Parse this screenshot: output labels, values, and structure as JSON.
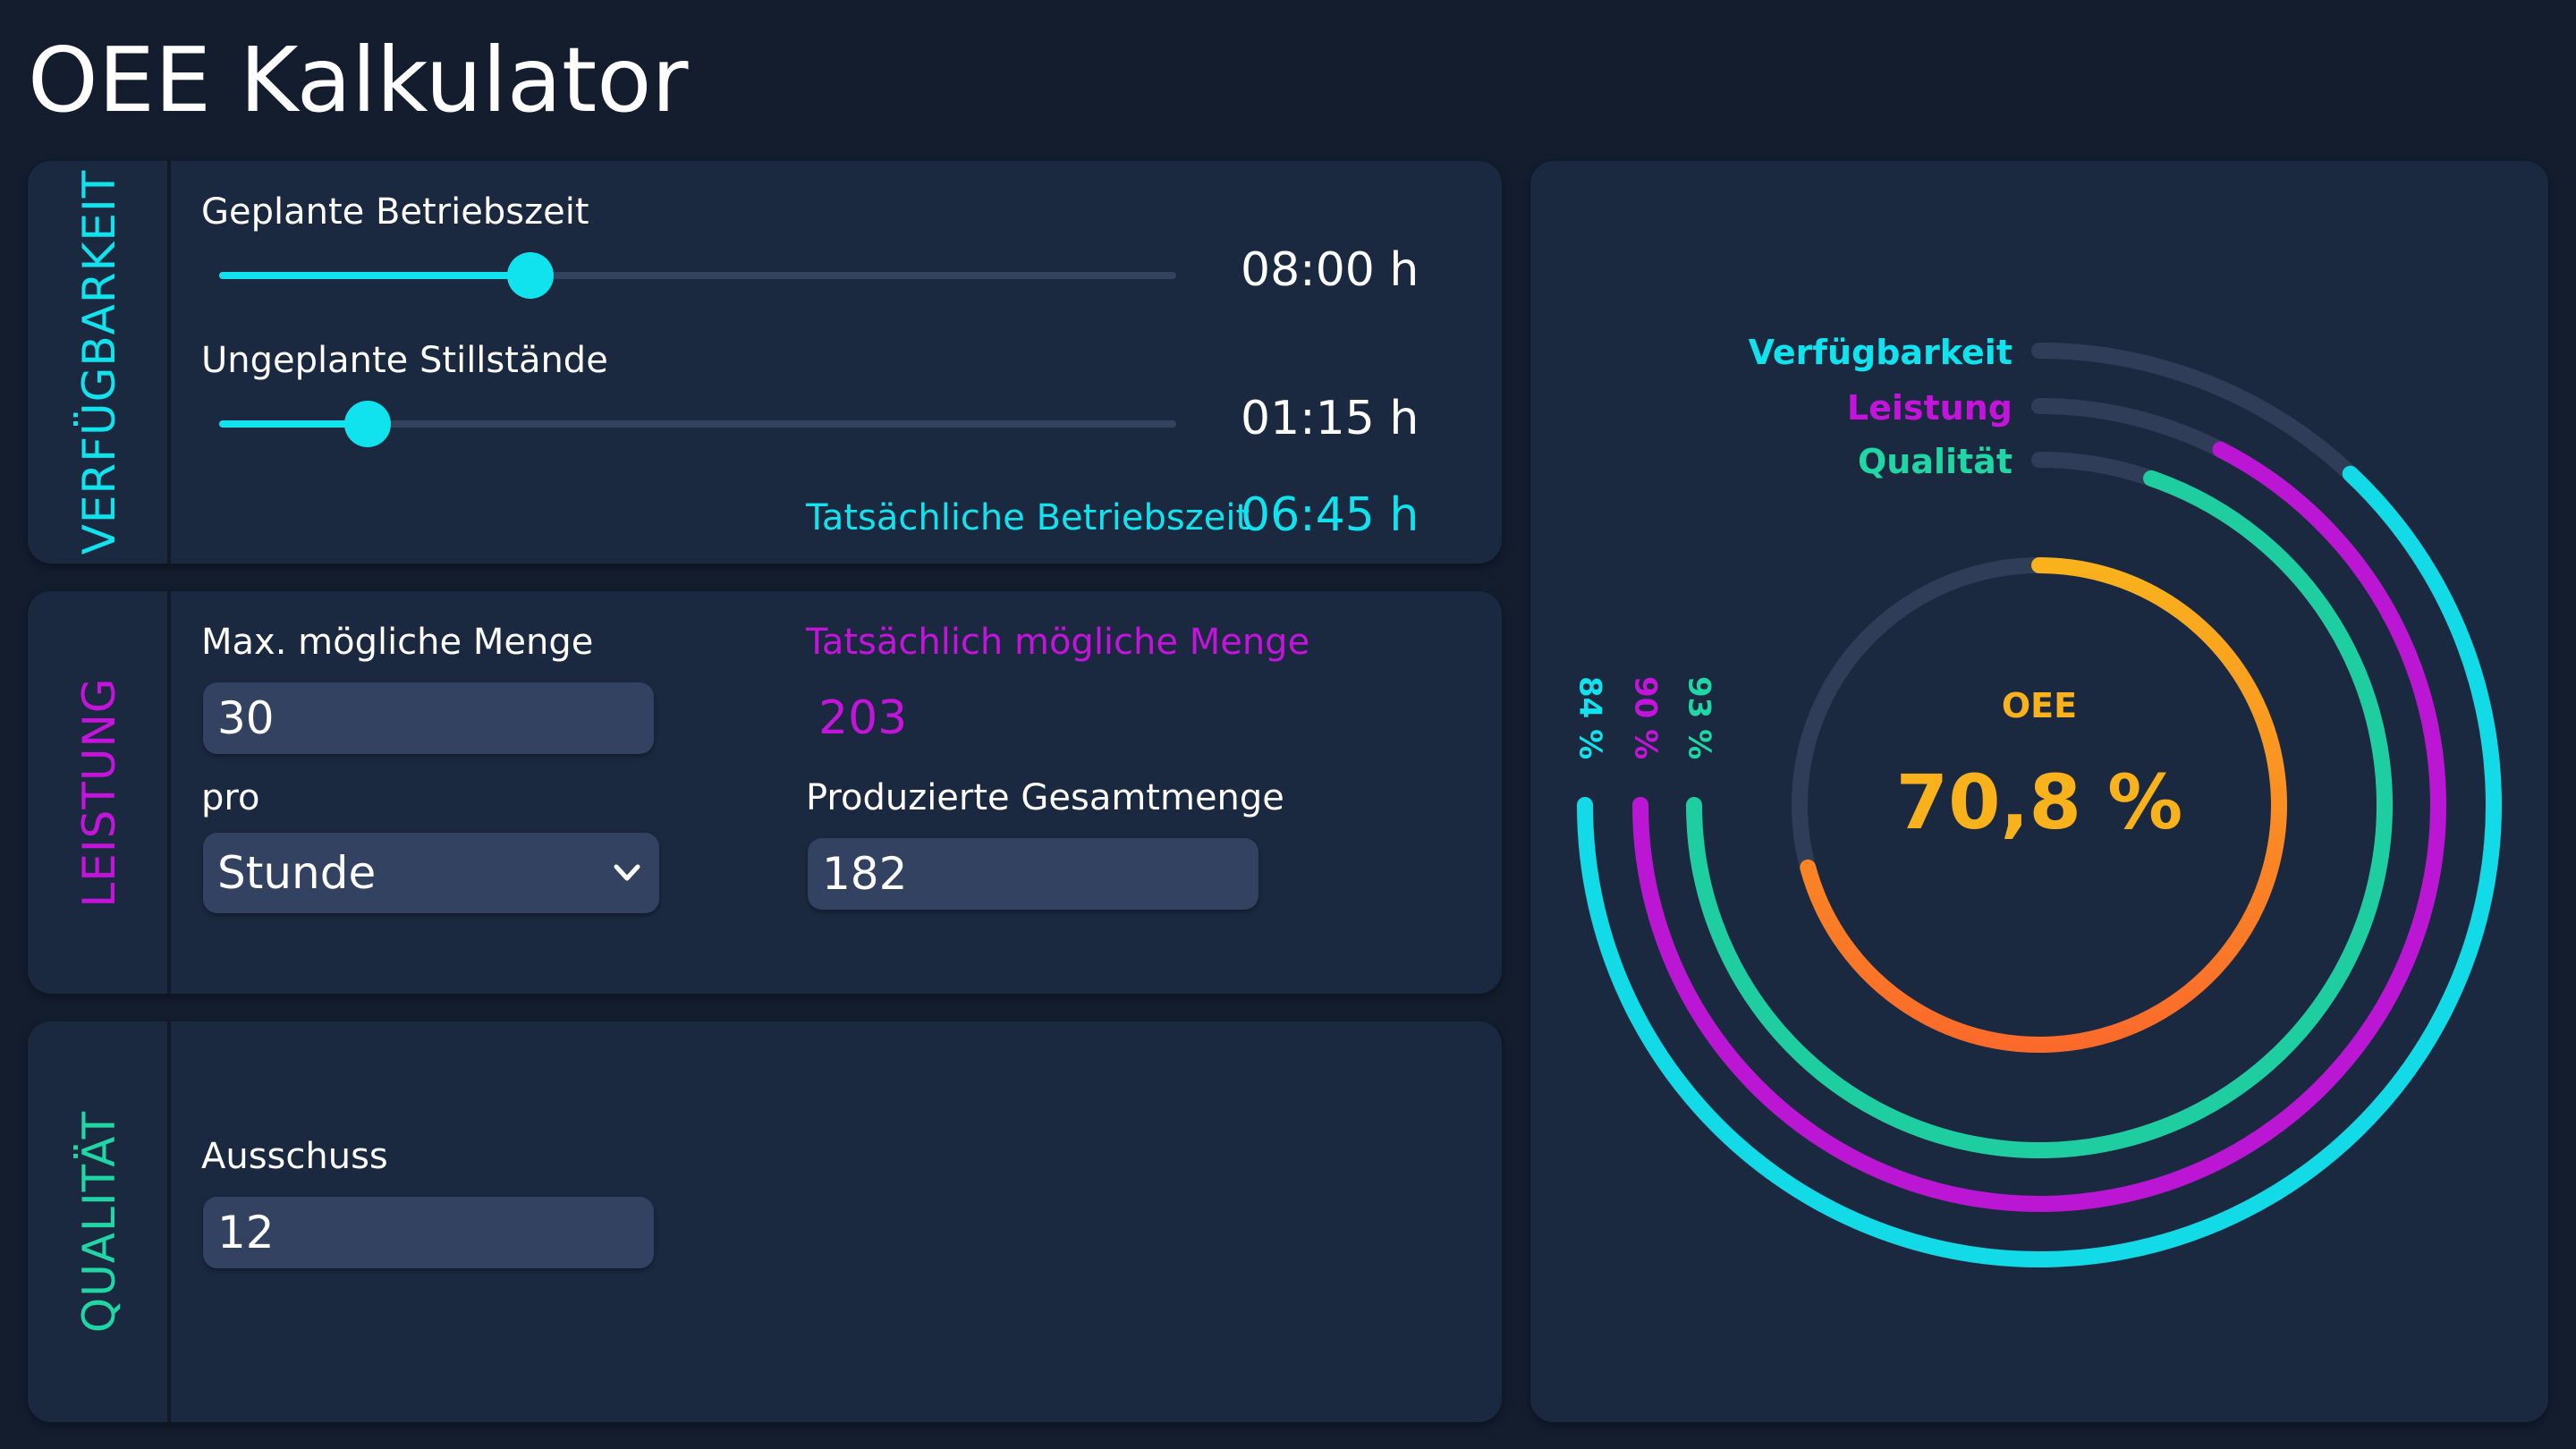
{
  "app": {
    "title": "OEE Kalkulator"
  },
  "colors": {
    "availability": "#11e3ee",
    "performance": "#c414dc",
    "quality": "#1fd6a4",
    "oee": "#f9b21c"
  },
  "availability_panel": {
    "label": "VERFÜGBARKEIT",
    "planned_label": "Geplante Betriebszeit",
    "planned_value": "08:00 h",
    "planned_slider": 0.325,
    "downtime_label": "Ungeplante Stillstände",
    "downtime_value": "01:15 h",
    "downtime_slider": 0.155,
    "actual_label": "Tatsächliche Betriebszeit",
    "actual_value": "06:45 h"
  },
  "performance_panel": {
    "label": "LEISTUNG",
    "max_qty_label": "Max. mögliche Menge",
    "max_qty_value": "30",
    "per_label": "pro",
    "per_value": "Stunde",
    "possible_qty_label": "Tatsächlich mögliche Menge",
    "possible_qty_value": "203",
    "total_qty_label": "Produzierte Gesamtmenge",
    "total_qty_value": "182"
  },
  "quality_panel": {
    "label": "QUALITÄT",
    "scrap_label": "Ausschuss",
    "scrap_value": "12"
  },
  "chart_data": {
    "type": "radial-bar",
    "series": [
      {
        "name": "Verfügbarkeit",
        "value": 84,
        "label": "84 %"
      },
      {
        "name": "Leistung",
        "value": 90,
        "label": "90 %"
      },
      {
        "name": "Qualität",
        "value": 93,
        "label": "93 %"
      }
    ],
    "oee": {
      "title": "OEE",
      "value": 70.8,
      "label": "70,8 %"
    }
  }
}
